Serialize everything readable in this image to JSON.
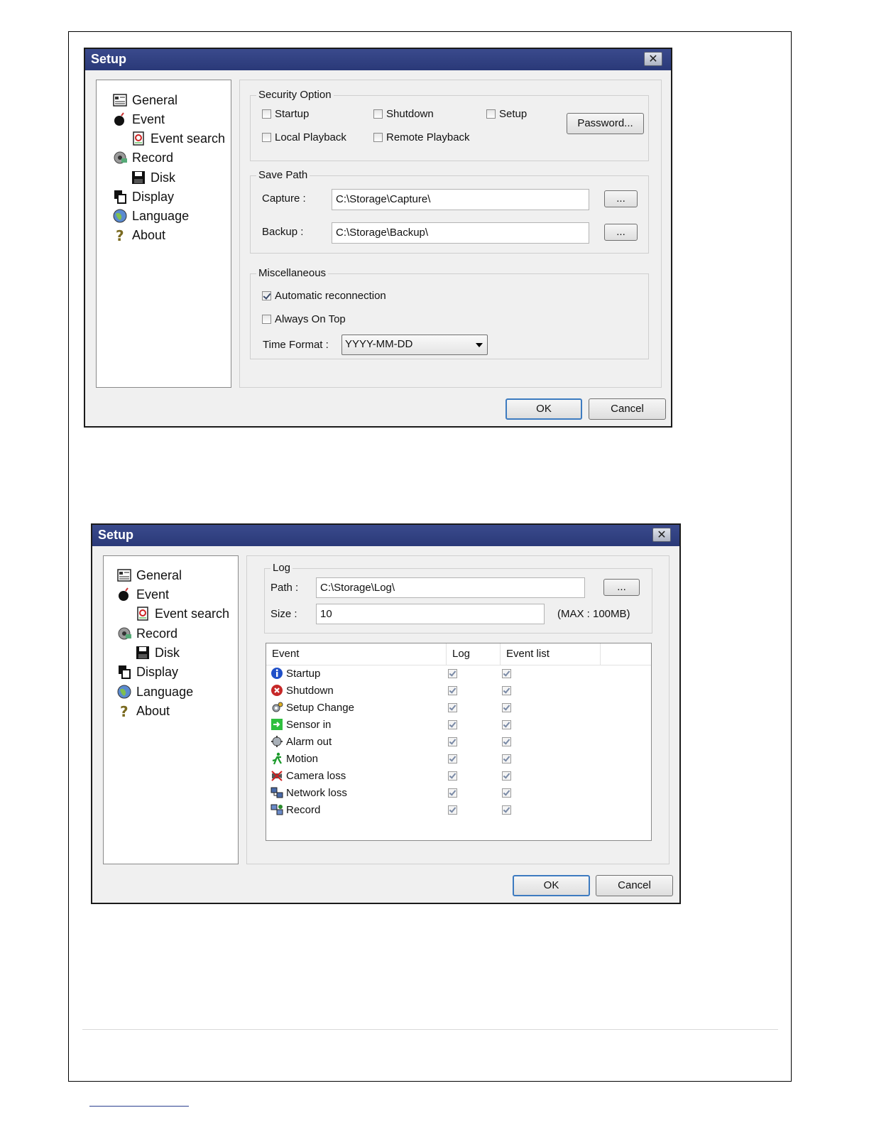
{
  "dialog1": {
    "title": "Setup",
    "close_glyph": "✕",
    "nav": [
      {
        "label": "General",
        "icon": "general-icon"
      },
      {
        "label": "Event",
        "icon": "event-icon"
      },
      {
        "label": "Event search",
        "icon": "event-search-icon"
      },
      {
        "label": "Record",
        "icon": "record-icon"
      },
      {
        "label": "Disk",
        "icon": "disk-icon"
      },
      {
        "label": "Display",
        "icon": "display-icon"
      },
      {
        "label": "Language",
        "icon": "language-icon"
      },
      {
        "label": "About",
        "icon": "about-icon"
      }
    ],
    "security": {
      "title": "Security Option",
      "startup": {
        "label": "Startup",
        "checked": false
      },
      "shutdown": {
        "label": "Shutdown",
        "checked": false
      },
      "setup": {
        "label": "Setup",
        "checked": false
      },
      "local_playback": {
        "label": "Local Playback",
        "checked": false
      },
      "remote_playback": {
        "label": "Remote Playback",
        "checked": false
      },
      "password_button": "Password..."
    },
    "save_path": {
      "title": "Save Path",
      "capture_label": "Capture :",
      "capture_value": "C:\\Storage\\Capture\\",
      "backup_label": "Backup :",
      "backup_value": "C:\\Storage\\Backup\\",
      "browse_label": "..."
    },
    "misc": {
      "title": "Miscellaneous",
      "auto_reconnect": {
        "label": "Automatic reconnection",
        "checked": true
      },
      "always_on_top": {
        "label": "Always On Top",
        "checked": false
      },
      "time_format_label": "Time Format :",
      "time_format_value": "YYYY-MM-DD"
    },
    "ok": "OK",
    "cancel": "Cancel"
  },
  "dialog2": {
    "title": "Setup",
    "close_glyph": "✕",
    "nav": [
      {
        "label": "General",
        "icon": "general-icon"
      },
      {
        "label": "Event",
        "icon": "event-icon"
      },
      {
        "label": "Event search",
        "icon": "event-search-icon"
      },
      {
        "label": "Record",
        "icon": "record-icon"
      },
      {
        "label": "Disk",
        "icon": "disk-icon"
      },
      {
        "label": "Display",
        "icon": "display-icon"
      },
      {
        "label": "Language",
        "icon": "language-icon"
      },
      {
        "label": "About",
        "icon": "about-icon"
      }
    ],
    "log": {
      "title": "Log",
      "path_label": "Path :",
      "path_value": "C:\\Storage\\Log\\",
      "browse_label": "...",
      "size_label": "Size :",
      "size_value": "10",
      "size_max": "(MAX : 100MB)"
    },
    "event_table": {
      "columns": [
        "Event",
        "Log",
        "Event list"
      ],
      "rows": [
        {
          "event": "Startup",
          "icon": "info-icon",
          "log": true,
          "event_list": true
        },
        {
          "event": "Shutdown",
          "icon": "shutdown-icon",
          "log": true,
          "event_list": true
        },
        {
          "event": "Setup Change",
          "icon": "setup-change-icon",
          "log": true,
          "event_list": true
        },
        {
          "event": "Sensor in",
          "icon": "sensor-in-icon",
          "log": true,
          "event_list": true
        },
        {
          "event": "Alarm out",
          "icon": "alarm-out-icon",
          "log": true,
          "event_list": true
        },
        {
          "event": "Motion",
          "icon": "motion-icon",
          "log": true,
          "event_list": true
        },
        {
          "event": "Camera loss",
          "icon": "camera-loss-icon",
          "log": true,
          "event_list": true
        },
        {
          "event": "Network loss",
          "icon": "network-loss-icon",
          "log": true,
          "event_list": true
        },
        {
          "event": "Record",
          "icon": "record-event-icon",
          "log": true,
          "event_list": true
        }
      ]
    },
    "ok": "OK",
    "cancel": "Cancel"
  },
  "colors": {
    "titlebar": "#2f3e80",
    "dialog_bg": "#f0f0f0",
    "default_button_border": "#3d7bc0"
  }
}
